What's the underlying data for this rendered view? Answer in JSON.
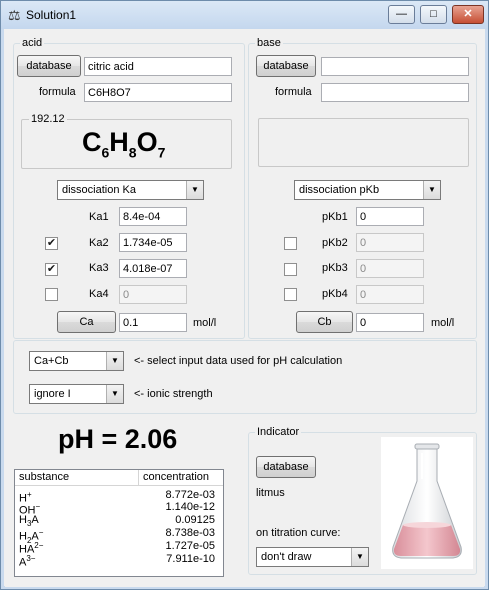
{
  "window": {
    "title": "Solution1",
    "min_glyph": "—",
    "max_glyph": "□",
    "close_glyph": "✕"
  },
  "acid": {
    "legend": "acid",
    "database_label": "database",
    "name_value": "citric acid",
    "formula_label": "formula",
    "formula_value": "C6H8O7",
    "molar_mass": "192.12",
    "formula_display": {
      "c": "C",
      "c_n": "6",
      "h": "H",
      "h_n": "8",
      "o": "O",
      "o_n": "7"
    },
    "dissociation_mode": "dissociation Ka",
    "constants": [
      {
        "label": "Ka1",
        "value": "8.4e-04",
        "checked": null,
        "enabled": true
      },
      {
        "label": "Ka2",
        "value": "1.734e-05",
        "checked": true,
        "enabled": true
      },
      {
        "label": "Ka3",
        "value": "4.018e-07",
        "checked": true,
        "enabled": true
      },
      {
        "label": "Ka4",
        "value": "0",
        "checked": false,
        "enabled": false
      }
    ],
    "conc_button": "Ca",
    "conc_value": "0.1",
    "conc_unit": "mol/l"
  },
  "base": {
    "legend": "base",
    "database_label": "database",
    "name_value": "",
    "formula_label": "formula",
    "formula_value": "",
    "dissociation_mode": "dissociation pKb",
    "constants": [
      {
        "label": "pKb1",
        "value": "0",
        "checked": null,
        "enabled": true
      },
      {
        "label": "pKb2",
        "value": "0",
        "checked": false,
        "enabled": false
      },
      {
        "label": "pKb3",
        "value": "0",
        "checked": false,
        "enabled": false
      },
      {
        "label": "pKb4",
        "value": "0",
        "checked": false,
        "enabled": false
      }
    ],
    "conc_button": "Cb",
    "conc_value": "0",
    "conc_unit": "mol/l"
  },
  "options": {
    "input_select": "Ca+Cb",
    "input_hint": "<- select input data used for pH calculation",
    "ionic_select": "ignore I",
    "ionic_hint": "<- ionic strength"
  },
  "result": {
    "ph_text": "pH = 2.06",
    "columns": [
      "substance",
      "concentration"
    ],
    "rows": [
      {
        "base": "H",
        "sub": "",
        "sup": "+",
        "value": "8.772e-03"
      },
      {
        "base": "OH",
        "sub": "",
        "sup": "−",
        "value": "1.140e-12"
      },
      {
        "base": "H",
        "sub": "3",
        "rest": "A",
        "sup": "",
        "value": "0.09125"
      },
      {
        "base": "H",
        "sub": "2",
        "rest": "A",
        "sup": "−",
        "value": "8.738e-03"
      },
      {
        "base": "HA",
        "sub": "",
        "sup": "2−",
        "value": "1.727e-05"
      },
      {
        "base": "A",
        "sub": "",
        "sup": "3−",
        "value": "7.911e-10"
      }
    ]
  },
  "indicator": {
    "legend": "Indicator",
    "database_label": "database",
    "name": "litmus",
    "titration_label": "on titration curve:",
    "titration_select": "don't draw"
  },
  "colors": {
    "solution": "#e9a9b2",
    "titlebar": "#c4d7ee"
  }
}
